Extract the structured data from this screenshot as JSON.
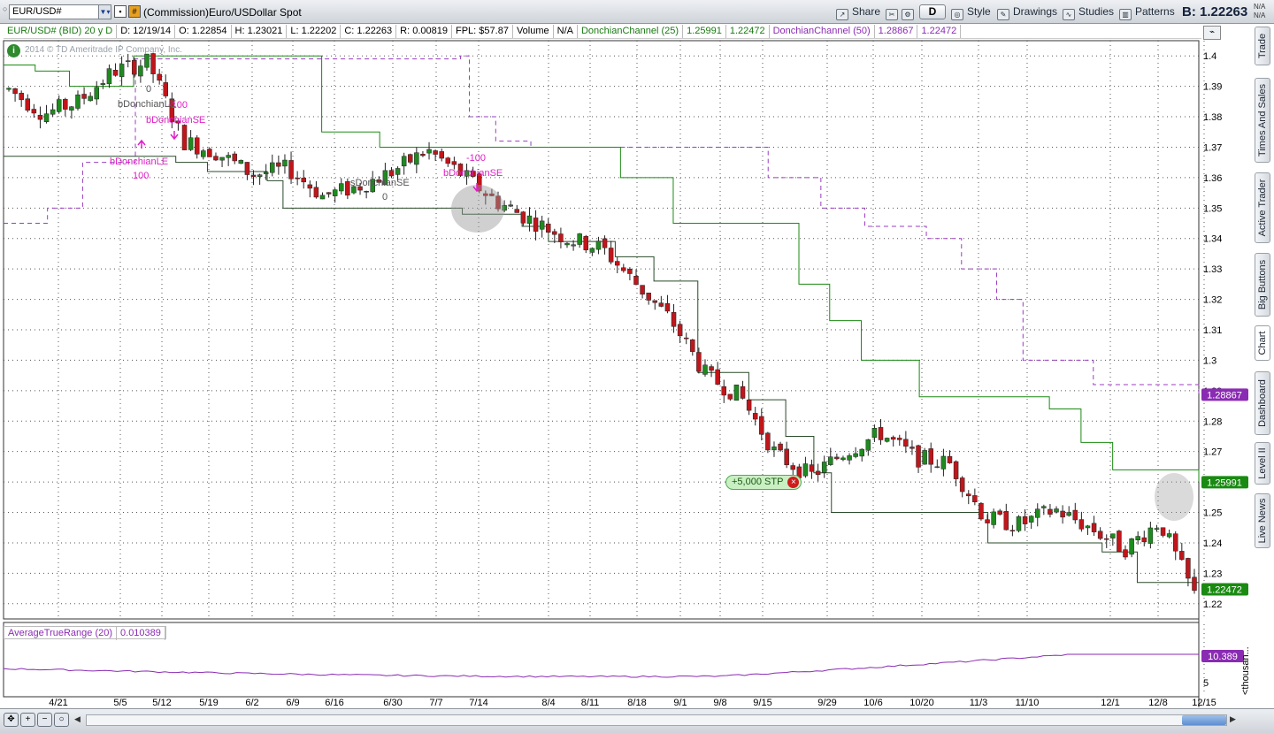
{
  "toolbar": {
    "symbol": "EUR/USD#",
    "description": "(Commission)Euro/USDollar Spot",
    "share": "Share",
    "timeframe": "D",
    "style": "Style",
    "drawings": "Drawings",
    "studies": "Studies",
    "patterns": "Patterns",
    "bid": "B: 1.22263",
    "na": "N/A"
  },
  "info": {
    "symbol": "EUR/USD# (BID) 20 y D",
    "date": "D: 12/19/14",
    "open": "O: 1.22854",
    "high": "H: 1.23021",
    "low": "L: 1.22202",
    "close": "C: 1.22263",
    "range": "R: 0.00819",
    "fpl": "FPL: $57.87",
    "volume": "Volume",
    "volume_val": "N/A",
    "dc25_label": "DonchianChannel (25)",
    "dc25_upper": "1.25991",
    "dc25_lower": "1.22472",
    "dc50_label": "DonchianChannel (50)",
    "dc50_upper": "1.28867",
    "dc50_lower": "1.22472"
  },
  "copyright": "2014 © TD Ameritrade IP Company, Inc.",
  "order_tag": "+5,000 STP",
  "atr": {
    "label": "AverageTrueRange (20)",
    "value": "0.010389",
    "scale_value": "10.389",
    "scale_tick": "5",
    "unit": "<thousan..."
  },
  "side_tabs": [
    "Trade",
    "Times And Sales",
    "Active Trader",
    "Big Buttons",
    "Chart",
    "Dashboard",
    "Level II",
    "Live News"
  ],
  "signals": {
    "labels": [
      "0",
      "bDonchianLE",
      "-100",
      "bDonchianSE",
      "bDonchianLE",
      "100",
      "sDonchianSE",
      "0",
      "-100",
      "bDonchianSE"
    ]
  },
  "colors": {
    "up": "#1f8a1f",
    "down": "#c0161b",
    "dc25": "#1a8a12",
    "dc50": "#9a3cc0",
    "lower": "#2a4a2a",
    "signal": "#e020c8",
    "atr": "#8a2bb3"
  },
  "chart_data": {
    "type": "candlestick",
    "price_axis": {
      "min": 1.215,
      "max": 1.405,
      "ticks": [
        1.4,
        1.39,
        1.38,
        1.37,
        1.36,
        1.35,
        1.34,
        1.33,
        1.32,
        1.31,
        1.3,
        1.29,
        1.28,
        1.27,
        1.26,
        1.25,
        1.24,
        1.23,
        1.22
      ]
    },
    "x_ticks": [
      "4/21",
      "5/5",
      "5/12",
      "5/19",
      "6/2",
      "6/9",
      "6/16",
      "6/30",
      "7/7",
      "7/14",
      "8/4",
      "8/11",
      "8/18",
      "9/1",
      "9/8",
      "9/15",
      "9/29",
      "10/6",
      "10/20",
      "11/3",
      "11/10",
      "12/1",
      "12/8",
      "12/15"
    ],
    "price_labels": [
      {
        "value": 1.28867,
        "text": "1.28867",
        "color": "#8a2bb3"
      },
      {
        "value": 1.25991,
        "text": "1.25991",
        "color": "#1a8a12"
      },
      {
        "value": 1.22472,
        "text": "1.22472",
        "color": "#1a8a12"
      }
    ],
    "close_path": [
      [
        "4/14",
        1.389
      ],
      [
        "4/21",
        1.381
      ],
      [
        "4/28",
        1.385
      ],
      [
        "5/5",
        1.395
      ],
      [
        "5/8",
        1.398
      ],
      [
        "5/12",
        1.372
      ],
      [
        "5/19",
        1.368
      ],
      [
        "5/26",
        1.361
      ],
      [
        "6/2",
        1.363
      ],
      [
        "6/9",
        1.354
      ],
      [
        "6/16",
        1.357
      ],
      [
        "6/23",
        1.362
      ],
      [
        "6/30",
        1.369
      ],
      [
        "7/7",
        1.361
      ],
      [
        "7/14",
        1.352
      ],
      [
        "7/21",
        1.346
      ],
      [
        "8/4",
        1.34
      ],
      [
        "8/11",
        1.337
      ],
      [
        "8/18",
        1.325
      ],
      [
        "9/1",
        1.313
      ],
      [
        "9/8",
        1.295
      ],
      [
        "9/15",
        1.288
      ],
      [
        "9/22",
        1.269
      ],
      [
        "9/29",
        1.262
      ],
      [
        "10/6",
        1.27
      ],
      [
        "10/13",
        1.276
      ],
      [
        "10/20",
        1.268
      ],
      [
        "10/27",
        1.266
      ],
      [
        "11/3",
        1.248
      ],
      [
        "11/10",
        1.246
      ],
      [
        "11/17",
        1.251
      ],
      [
        "11/24",
        1.245
      ],
      [
        "12/1",
        1.238
      ],
      [
        "12/8",
        1.247
      ],
      [
        "12/15",
        1.223
      ]
    ],
    "dc25_upper": [
      [
        0,
        1.397
      ],
      [
        36,
        1.395
      ],
      [
        75,
        1.39
      ],
      [
        148,
        1.4
      ],
      [
        338,
        1.4
      ],
      [
        362,
        1.375
      ],
      [
        428,
        1.37
      ],
      [
        620,
        1.37
      ],
      [
        702,
        1.36
      ],
      [
        762,
        1.345
      ],
      [
        905,
        1.325
      ],
      [
        940,
        1.313
      ],
      [
        976,
        1.3
      ],
      [
        1042,
        1.288
      ],
      [
        1190,
        1.284
      ],
      [
        1226,
        1.273
      ],
      [
        1262,
        1.264
      ],
      [
        1360,
        1.26
      ]
    ],
    "dc25_lower": [
      [
        0,
        1.367
      ],
      [
        160,
        1.367
      ],
      [
        196,
        1.365
      ],
      [
        232,
        1.362
      ],
      [
        300,
        1.359
      ],
      [
        318,
        1.35
      ],
      [
        490,
        1.35
      ],
      [
        522,
        1.348
      ],
      [
        590,
        1.344
      ],
      [
        620,
        1.339
      ],
      [
        696,
        1.334
      ],
      [
        740,
        1.326
      ],
      [
        790,
        1.296
      ],
      [
        848,
        1.287
      ],
      [
        890,
        1.275
      ],
      [
        922,
        1.263
      ],
      [
        942,
        1.25
      ],
      [
        1092,
        1.25
      ],
      [
        1120,
        1.24
      ],
      [
        1250,
        1.237
      ],
      [
        1290,
        1.227
      ],
      [
        1360,
        1.227
      ]
    ],
    "dc50_upper": [
      [
        0,
        1.345
      ],
      [
        50,
        1.35
      ],
      [
        90,
        1.365
      ],
      [
        150,
        1.399
      ],
      [
        520,
        1.4
      ],
      [
        530,
        1.38
      ],
      [
        560,
        1.372
      ],
      [
        600,
        1.37
      ],
      [
        820,
        1.37
      ],
      [
        870,
        1.36
      ],
      [
        930,
        1.35
      ],
      [
        980,
        1.344
      ],
      [
        1050,
        1.34
      ],
      [
        1090,
        1.33
      ],
      [
        1130,
        1.32
      ],
      [
        1160,
        1.3
      ],
      [
        1240,
        1.292
      ],
      [
        1360,
        1.289
      ]
    ]
  }
}
